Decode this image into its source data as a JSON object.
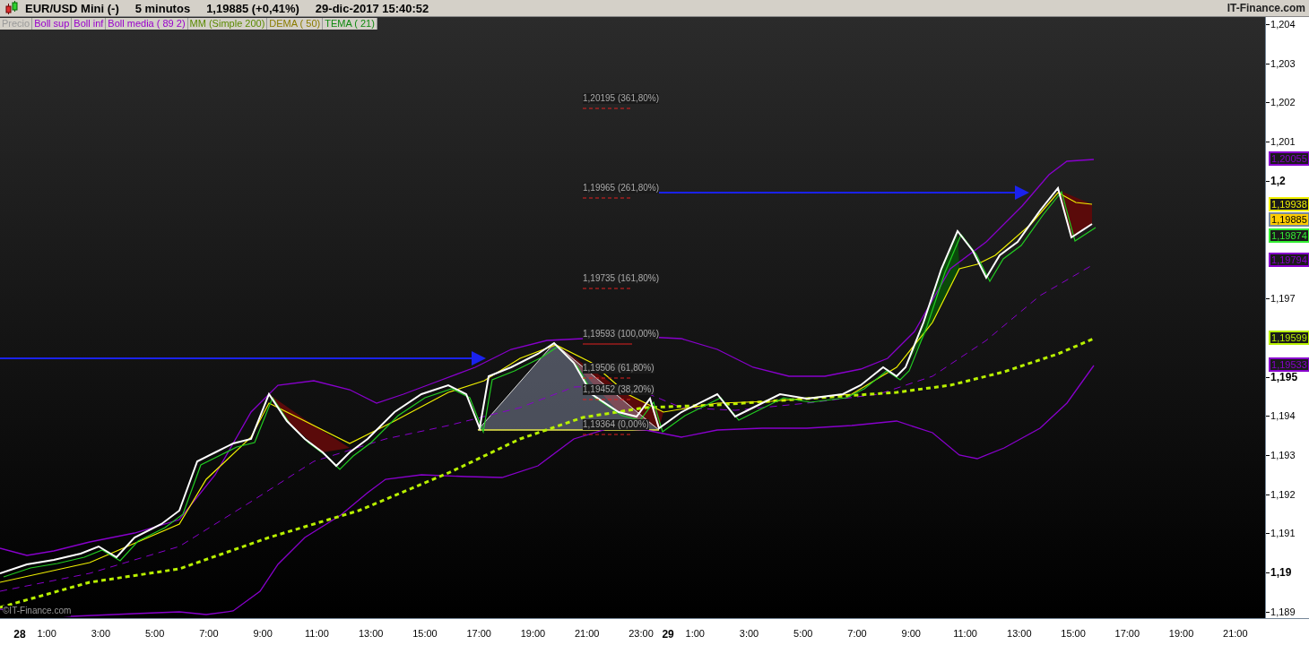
{
  "header": {
    "symbol": "EUR/USD Mini (-)",
    "interval": "5 minutos",
    "price": "1,19885 (+0,41%)",
    "datetime": "29-dic-2017 15:40:52",
    "site": "IT-Finance.com"
  },
  "legend": [
    {
      "label": "Precio",
      "color": "#9a9a9a"
    },
    {
      "label": "Boll sup",
      "color": "#9900cc"
    },
    {
      "label": "Boll inf",
      "color": "#9900cc"
    },
    {
      "label": "Boll media ( 89 2)",
      "color": "#9900cc"
    },
    {
      "label": "MM (Simple 200)",
      "color": "#5a8a00"
    },
    {
      "label": "DEMA ( 50)",
      "color": "#8a7c00"
    },
    {
      "label": "TEMA ( 21)",
      "color": "#108a10"
    }
  ],
  "chart": {
    "fib_levels": [
      "1,20195 (361,80%)",
      "1,19965 (261,80%)",
      "1,19735 (161,80%)",
      "1,19593 (100,00%)",
      "1,19506 (61,80%)",
      "1,19452 (38,20%)",
      "1,19364 (0,00%)"
    ],
    "credit": "©IT-Finance.com"
  },
  "y_axis": {
    "ticks": [
      {
        "label": "1,204",
        "kind": "minor"
      },
      {
        "label": "1,203",
        "kind": "minor"
      },
      {
        "label": "1,202",
        "kind": "minor"
      },
      {
        "label": "1,201",
        "kind": "minor"
      },
      {
        "label": "1,2",
        "kind": "major"
      },
      {
        "label": "1,197",
        "kind": "minor"
      },
      {
        "label": "1,195",
        "kind": "major"
      },
      {
        "label": "1,194",
        "kind": "minor"
      },
      {
        "label": "1,193",
        "kind": "minor"
      },
      {
        "label": "1,192",
        "kind": "minor"
      },
      {
        "label": "1,191",
        "kind": "minor"
      },
      {
        "label": "1,19",
        "kind": "major"
      },
      {
        "label": "1,189",
        "kind": "minor"
      }
    ],
    "badges": [
      {
        "label": "1,20055",
        "kind": "indicator",
        "color": "#8800cc"
      },
      {
        "label": "1,19938",
        "kind": "indicator",
        "color": "#f0f000"
      },
      {
        "label": "1,19885",
        "kind": "current",
        "color": "#ffcc00"
      },
      {
        "label": "1,19874",
        "kind": "indicator",
        "color": "#33ee33"
      },
      {
        "label": "1,19794",
        "kind": "indicator",
        "color": "#8800cc"
      },
      {
        "label": "1,19599",
        "kind": "indicator",
        "color": "#b8f000"
      },
      {
        "label": "1,19533",
        "kind": "indicator",
        "color": "#8800cc"
      }
    ]
  },
  "x_axis": {
    "ticks": [
      {
        "label": "28",
        "kind": "date"
      },
      {
        "label": "1:00",
        "kind": "time"
      },
      {
        "label": "3:00",
        "kind": "time"
      },
      {
        "label": "5:00",
        "kind": "time"
      },
      {
        "label": "7:00",
        "kind": "time"
      },
      {
        "label": "9:00",
        "kind": "time"
      },
      {
        "label": "11:00",
        "kind": "time"
      },
      {
        "label": "13:00",
        "kind": "time"
      },
      {
        "label": "15:00",
        "kind": "time"
      },
      {
        "label": "17:00",
        "kind": "time"
      },
      {
        "label": "19:00",
        "kind": "time"
      },
      {
        "label": "21:00",
        "kind": "time"
      },
      {
        "label": "23:00",
        "kind": "time"
      },
      {
        "label": "29",
        "kind": "date"
      },
      {
        "label": "1:00",
        "kind": "time"
      },
      {
        "label": "3:00",
        "kind": "time"
      },
      {
        "label": "5:00",
        "kind": "time"
      },
      {
        "label": "7:00",
        "kind": "time"
      },
      {
        "label": "9:00",
        "kind": "time"
      },
      {
        "label": "11:00",
        "kind": "time"
      },
      {
        "label": "13:00",
        "kind": "time"
      },
      {
        "label": "15:00",
        "kind": "time"
      },
      {
        "label": "17:00",
        "kind": "time"
      },
      {
        "label": "19:00",
        "kind": "time"
      },
      {
        "label": "21:00",
        "kind": "time"
      }
    ]
  }
}
